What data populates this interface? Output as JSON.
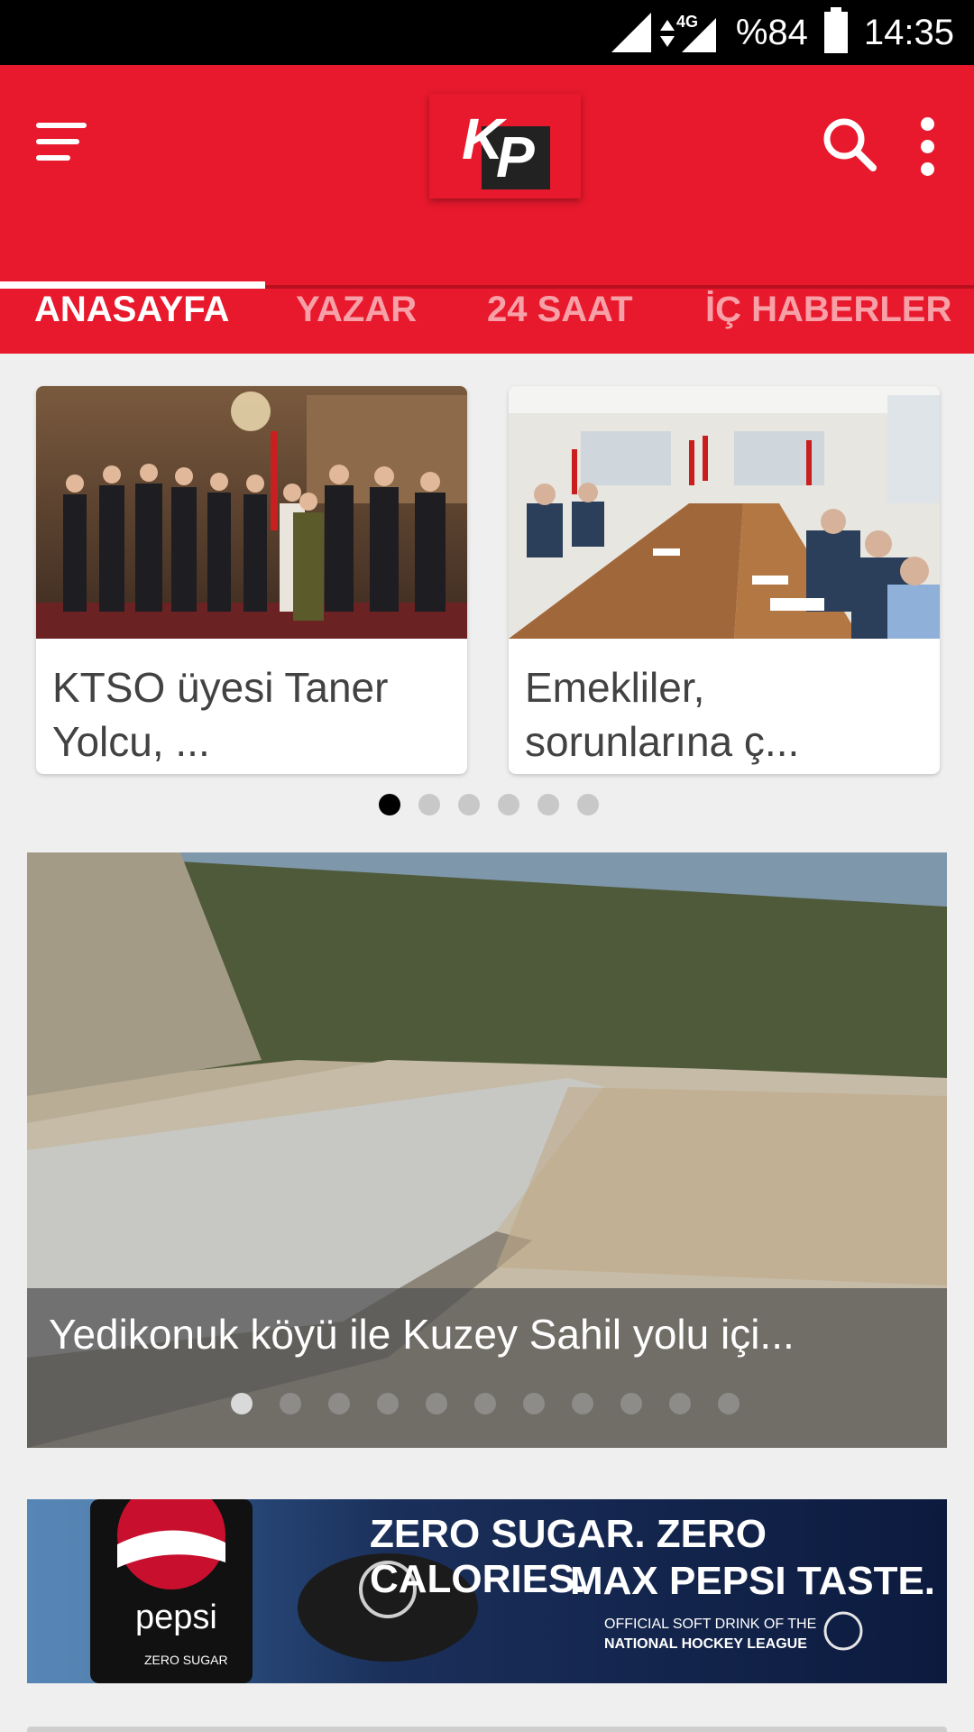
{
  "status_bar": {
    "network": "4G",
    "battery": "%84",
    "time": "14:35"
  },
  "app_bar": {
    "logo_text": "KP",
    "brand_color": "#e8192c"
  },
  "tabs": [
    {
      "label": "ANASAYFA",
      "active": true
    },
    {
      "label": "YAZAR",
      "active": false
    },
    {
      "label": "24 SAAT",
      "active": false
    },
    {
      "label": "İÇ HABERLER",
      "active": false
    }
  ],
  "featured_cards": [
    {
      "title": "KTSO üyesi Taner Yolcu, ..."
    },
    {
      "title": "Emekliler, sorunlarına ç..."
    }
  ],
  "card_pager": {
    "count": 6,
    "active_index": 0
  },
  "hero": {
    "title": "Yedikonuk köyü ile Kuzey Sahil yolu içi...",
    "pager": {
      "count": 11,
      "active_index": 0
    }
  },
  "ad": {
    "brand": "pepsi",
    "sub_brand": "ZERO SUGAR",
    "headline_1": "ZERO SUGAR. ZERO CALORIES.",
    "headline_2": "MAX PEPSI TASTE.",
    "tagline_1": "OFFICIAL SOFT DRINK OF THE",
    "tagline_2": "NATIONAL HOCKEY LEAGUE"
  }
}
